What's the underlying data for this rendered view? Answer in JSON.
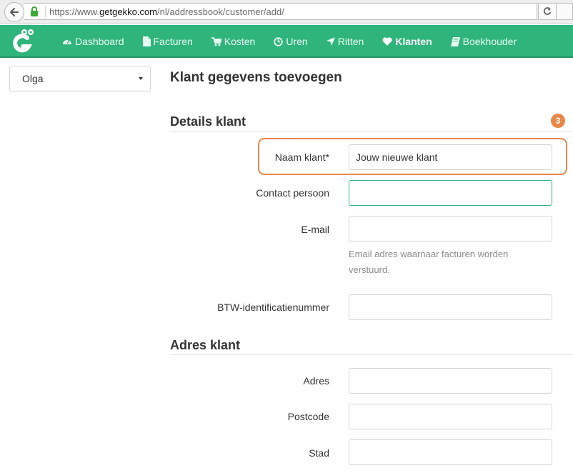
{
  "browser": {
    "url_prefix": "https://www.",
    "url_host": "getgekko.com",
    "url_path": "/nl/addressbook/customer/add/"
  },
  "nav": {
    "items": [
      {
        "label": "Dashboard",
        "icon": "dashboard-icon"
      },
      {
        "label": "Facturen",
        "icon": "file-icon"
      },
      {
        "label": "Kosten",
        "icon": "cart-icon"
      },
      {
        "label": "Uren",
        "icon": "clock-icon"
      },
      {
        "label": "Ritten",
        "icon": "location-arrow-icon"
      },
      {
        "label": "Klanten",
        "icon": "heart-icon"
      },
      {
        "label": "Boekhouder",
        "icon": "book-icon"
      }
    ],
    "active": "Klanten",
    "accent_color": "#2fb47c"
  },
  "sidebar": {
    "selected_user": "Olga"
  },
  "page": {
    "title": "Klant gegevens toevoegen",
    "step_badge": "3",
    "highlight_color": "#e9874b"
  },
  "details_section": {
    "title": "Details klant",
    "fields": {
      "name": {
        "label": "Naam klant*",
        "value": "Jouw nieuwe klant"
      },
      "contact": {
        "label": "Contact persoon",
        "value": ""
      },
      "email": {
        "label": "E-mail",
        "value": "",
        "help": "Email adres waarnaar facturen worden verstuurd."
      },
      "vat": {
        "label": "BTW-identificatienummer",
        "value": ""
      }
    }
  },
  "address_section": {
    "title": "Adres klant",
    "fields": {
      "address": {
        "label": "Adres",
        "value": ""
      },
      "postcode": {
        "label": "Postcode",
        "value": ""
      },
      "city": {
        "label": "Stad",
        "value": ""
      }
    }
  }
}
